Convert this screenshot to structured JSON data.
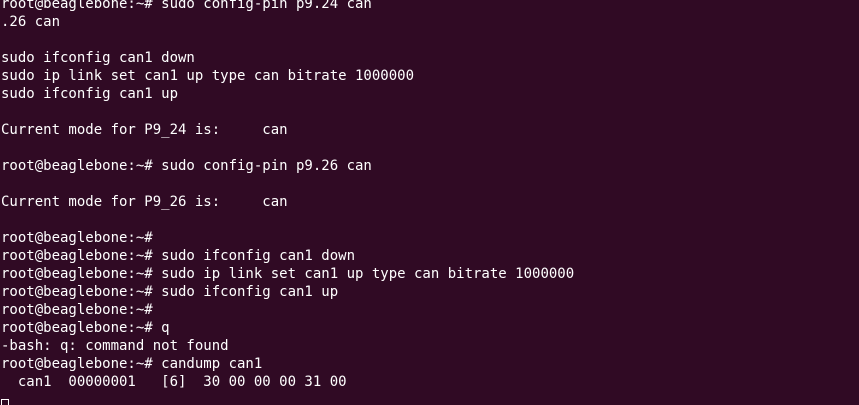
{
  "terminal": {
    "lines": [
      "root@beaglebone:~# sudo config-pin p9.24 can",
      ".26 can",
      "",
      "sudo ifconfig can1 down",
      "sudo ip link set can1 up type can bitrate 1000000",
      "sudo ifconfig can1 up",
      "",
      "Current mode for P9_24 is:     can",
      "",
      "root@beaglebone:~# sudo config-pin p9.26 can",
      "",
      "Current mode for P9_26 is:     can",
      "",
      "root@beaglebone:~#",
      "root@beaglebone:~# sudo ifconfig can1 down",
      "root@beaglebone:~# sudo ip link set can1 up type can bitrate 1000000",
      "root@beaglebone:~# sudo ifconfig can1 up",
      "root@beaglebone:~#",
      "root@beaglebone:~# q",
      "-bash: q: command not found",
      "root@beaglebone:~# candump can1",
      "  can1  00000001   [6]  30 00 00 00 31 00"
    ]
  },
  "colors": {
    "background": "#300a24",
    "foreground": "#ffffff"
  }
}
